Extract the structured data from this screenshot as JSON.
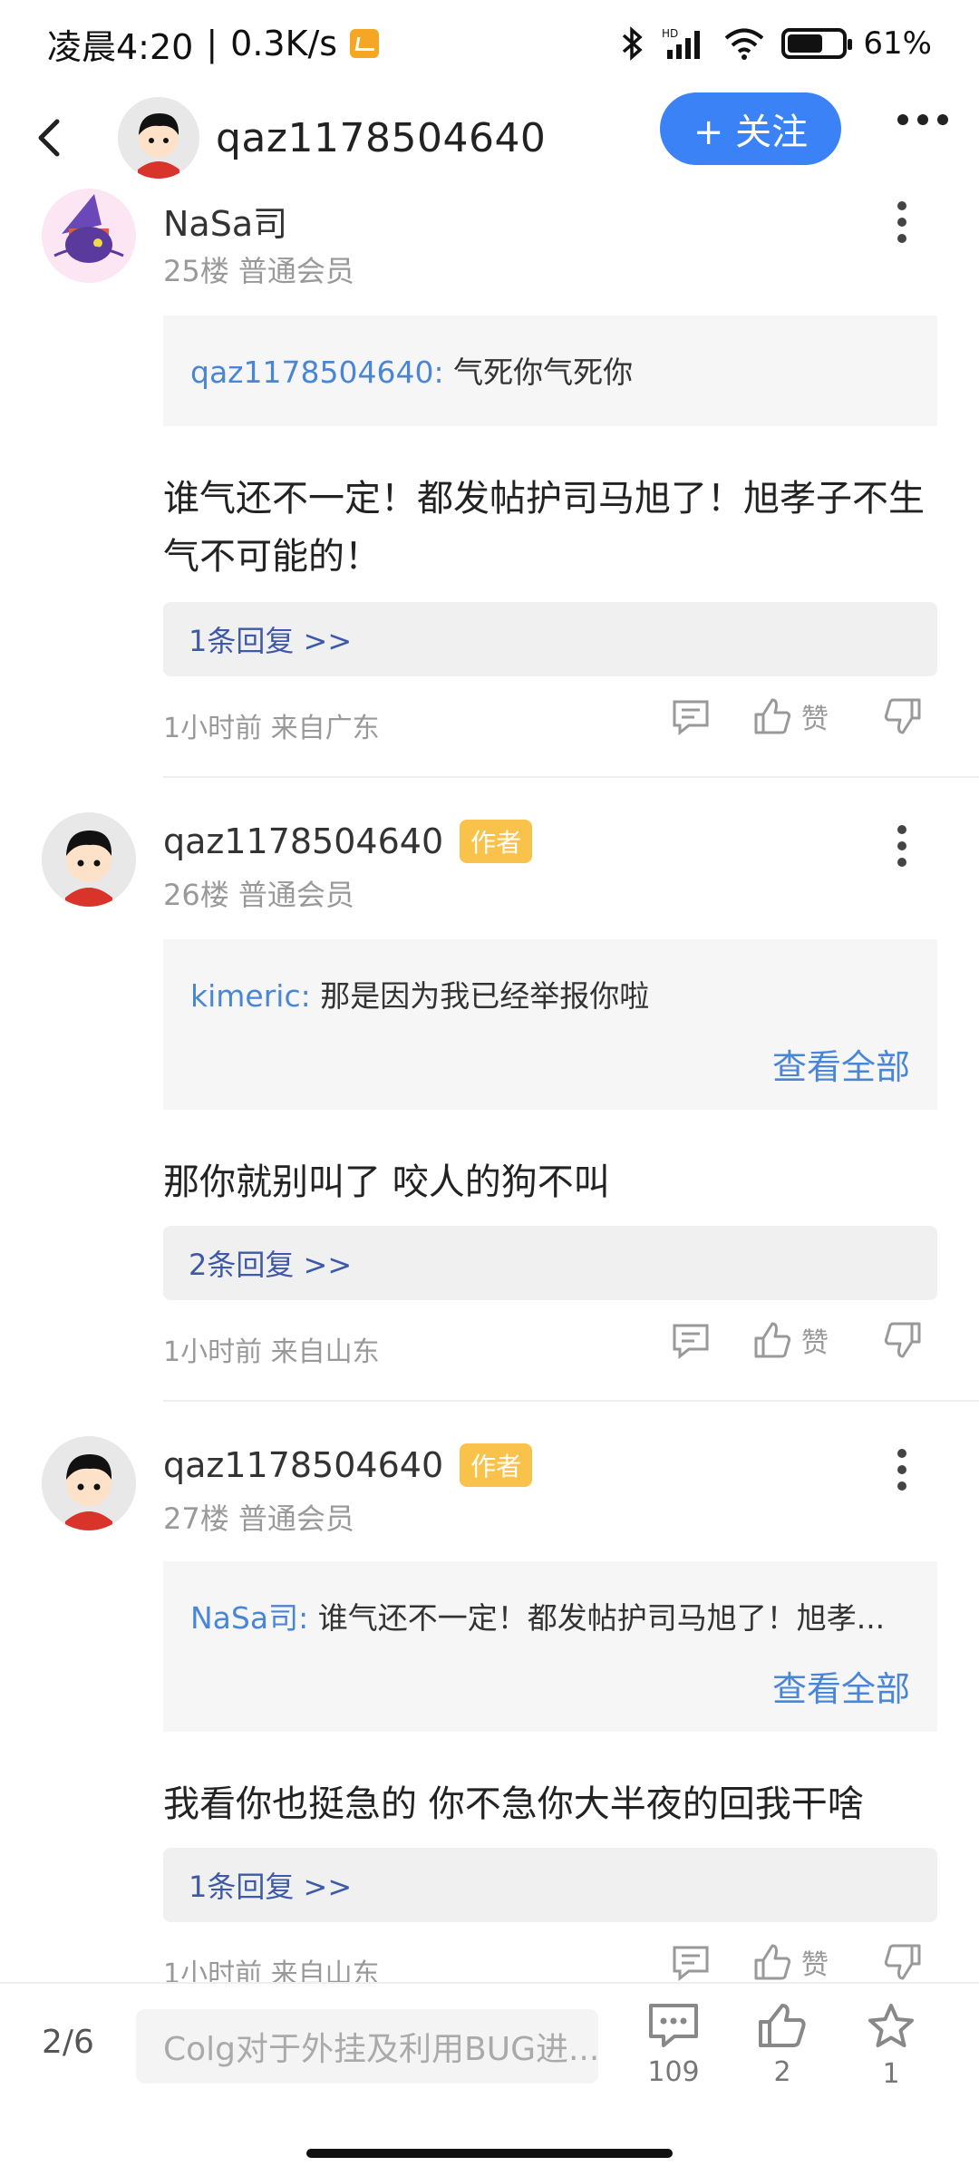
{
  "status_bar": {
    "time": "凌晨4:20",
    "speed": "0.3K/s",
    "battery": "61%"
  },
  "header": {
    "username": "qaz1178504640",
    "follow_label": "+ 关注"
  },
  "posts": [
    {
      "author": "NaSa司",
      "tag": "",
      "meta": "25楼 普通会员",
      "quote_user": "qaz1178504640:",
      "quote_text": "气死你气死你",
      "quote_more": "",
      "content": "谁气还不一定！都发帖护司马旭了！旭孝子不生气不可能的！",
      "replies": "1条回复 >>",
      "footer": "1小时前 来自广东",
      "like_label": "赞"
    },
    {
      "author": "qaz1178504640",
      "tag": "作者",
      "meta": "26楼 普通会员",
      "quote_user": "kimeric:",
      "quote_text": "那是因为我已经举报你啦",
      "quote_more": "查看全部",
      "content": "那你就别叫了 咬人的狗不叫",
      "replies": "2条回复 >>",
      "footer": "1小时前 来自山东",
      "like_label": "赞"
    },
    {
      "author": "qaz1178504640",
      "tag": "作者",
      "meta": "27楼 普通会员",
      "quote_user": "NaSa司:",
      "quote_text": "谁气还不一定！都发帖护司马旭了！旭孝...",
      "quote_more": "查看全部",
      "content": "我看你也挺急的 你不急你大半夜的回我干啥",
      "replies": "1条回复 >>",
      "footer": "1小时前 来自山东",
      "like_label": "赞"
    }
  ],
  "bottom_bar": {
    "page": "2/6",
    "input_placeholder": "Colg对于外挂及利用BUG进...",
    "comments_count": "109",
    "likes_count": "2",
    "favorites_count": "1"
  },
  "colors": {
    "accent": "#3b82f6",
    "link": "#4a86d6",
    "author_tag": "#f8c24b"
  },
  "icons": [
    "back-icon",
    "bluetooth-icon",
    "signal-icon",
    "wifi-icon",
    "battery-icon",
    "more-icon",
    "comment-icon",
    "like-icon",
    "dislike-icon",
    "star-icon"
  ]
}
